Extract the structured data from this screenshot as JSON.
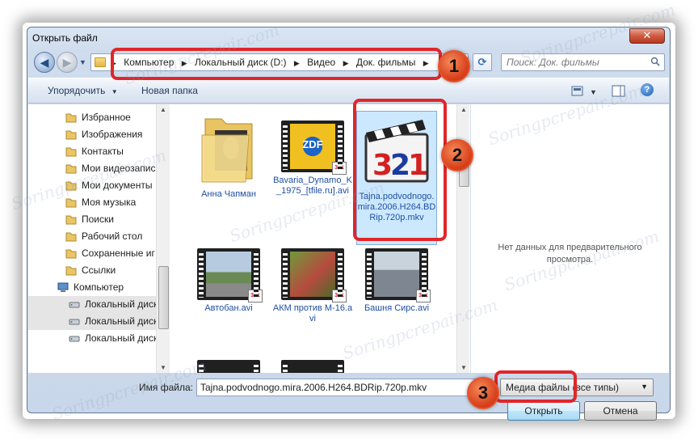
{
  "window": {
    "title": "Открыть файл",
    "close_symbol": "✕"
  },
  "address": {
    "crumbs": [
      "Компьютер",
      "Локальный диск (D:)",
      "Видео",
      "Док. фильмы"
    ],
    "search_placeholder": "Поиск: Док. фильмы"
  },
  "toolbar": {
    "organize": "Упорядочить",
    "new_folder": "Новая папка"
  },
  "sidebar": {
    "items": [
      {
        "label": "Избранное",
        "icon": "folder-icon"
      },
      {
        "label": "Изображения",
        "icon": "folder-icon"
      },
      {
        "label": "Контакты",
        "icon": "folder-icon"
      },
      {
        "label": "Мои видеозапис",
        "icon": "folder-icon"
      },
      {
        "label": "Мои документы",
        "icon": "folder-icon"
      },
      {
        "label": "Моя музыка",
        "icon": "folder-icon"
      },
      {
        "label": "Поиски",
        "icon": "folder-icon"
      },
      {
        "label": "Рабочий стол",
        "icon": "folder-icon"
      },
      {
        "label": "Сохраненные иг",
        "icon": "folder-icon"
      },
      {
        "label": "Ссылки",
        "icon": "folder-icon"
      },
      {
        "label": "Компьютер",
        "icon": "computer-icon"
      },
      {
        "label": "Локальный диск",
        "icon": "drive-icon"
      },
      {
        "label": "Локальный диск",
        "icon": "drive-icon"
      },
      {
        "label": "Локальный диск",
        "icon": "drive-icon"
      }
    ]
  },
  "files": [
    {
      "name": "Анна Чапман",
      "kind": "folder"
    },
    {
      "name": "Bavaria_Dynamo_K_1975_[tfile.ru].avi",
      "kind": "video-zdf"
    },
    {
      "name": "Tajna.podvodnogo.mira.2006.H264.BDRip.720p.mkv",
      "kind": "mkv-321",
      "selected": true
    },
    {
      "name": "Автобан.avi",
      "kind": "video-road"
    },
    {
      "name": "АКМ против М-16.avi",
      "kind": "video-akm"
    },
    {
      "name": "Башня Сирс.avi",
      "kind": "video-city"
    }
  ],
  "preview": {
    "text": "Нет данных для предварительного просмотра."
  },
  "bottom": {
    "filename_label": "Имя файла:",
    "filename_value": "Tajna.podvodnogo.mira.2006.H264.BDRip.720p.mkv",
    "filetype_value": "Медиа файлы (все типы)",
    "open_label": "Открыть",
    "cancel_label": "Отмена"
  },
  "markers": [
    "1",
    "2",
    "3"
  ],
  "watermark": "Soringpcrepair.com",
  "colors": {
    "highlight": "#e0262a",
    "marker": "#e0522a",
    "link": "#1d4fa3"
  }
}
